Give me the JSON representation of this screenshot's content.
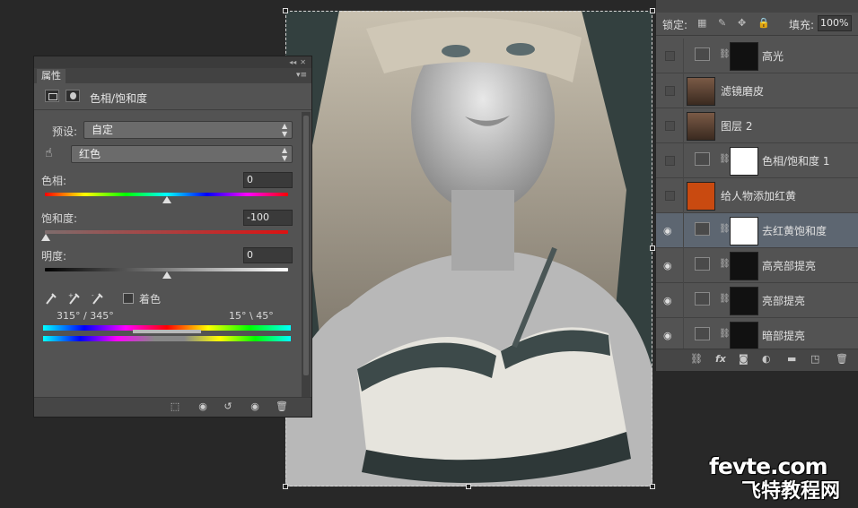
{
  "properties_panel": {
    "tab_label": "属性",
    "title": "色相/饱和度",
    "preset_label": "预设:",
    "preset_value": "自定",
    "channel_value": "红色",
    "hue": {
      "label": "色相:",
      "value": "0",
      "position": 0.5
    },
    "saturation": {
      "label": "饱和度:",
      "value": "-100",
      "position": 0.0
    },
    "lightness": {
      "label": "明度:",
      "value": "0",
      "position": 0.5
    },
    "colorize_label": "着色",
    "range_left": "315° / 345°",
    "range_right": "15° \\ 45°",
    "icons": [
      "adjustment-layer-icon",
      "mask-icon",
      "eyedropper-icon",
      "eyedropper-plus-icon",
      "eyedropper-minus-icon",
      "clip-to-layer-icon",
      "view-previous-icon",
      "reset-icon",
      "visibility-icon",
      "delete-icon"
    ]
  },
  "layers_panel": {
    "lock_label": "锁定:",
    "fill_label": "填充:",
    "fill_value": "100%",
    "layers": [
      {
        "name": "高光",
        "visible": false,
        "type": "curves",
        "selected": false
      },
      {
        "name": "滤镜磨皮",
        "visible": false,
        "type": "photo",
        "selected": false
      },
      {
        "name": "图层 2",
        "visible": false,
        "type": "photo",
        "selected": false
      },
      {
        "name": "色相/饱和度 1",
        "visible": false,
        "type": "huesat",
        "selected": false
      },
      {
        "name": "给人物添加红黄",
        "visible": false,
        "type": "solid",
        "color": "#c94a10",
        "selected": false
      },
      {
        "name": "去红黄饱和度",
        "visible": true,
        "type": "huesat",
        "selected": true
      },
      {
        "name": "高亮部提亮",
        "visible": true,
        "type": "curves",
        "selected": false
      },
      {
        "name": "亮部提亮",
        "visible": true,
        "type": "curves",
        "selected": false
      },
      {
        "name": "暗部提亮",
        "visible": true,
        "type": "curves",
        "selected": false
      }
    ],
    "footer_icons": [
      "link-icon",
      "fx-icon",
      "mask-icon",
      "adjustment-icon",
      "folder-icon",
      "new-layer-icon",
      "delete-icon"
    ]
  },
  "watermark": {
    "line1": "fevte.com",
    "line2": "飞特教程网"
  }
}
